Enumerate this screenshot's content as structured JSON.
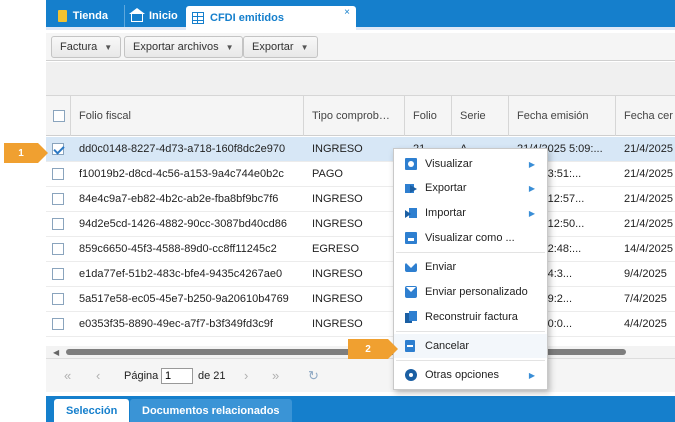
{
  "tabs": [
    {
      "label": "Tienda",
      "icon": "folder-icon"
    },
    {
      "label": "Inicio",
      "icon": "home-icon"
    },
    {
      "label": "CFDI emitidos",
      "icon": "grid-icon",
      "close": "×"
    }
  ],
  "toolbar": {
    "factura": "Factura",
    "exportar_archivos": "Exportar archivos",
    "exportar": "Exportar"
  },
  "columns": {
    "folio_fiscal": "Folio fiscal",
    "tipo": "Tipo comprob…",
    "folio": "Folio",
    "serie": "Serie",
    "fecha_emision": "Fecha emisión",
    "fecha_cert": "Fecha cer"
  },
  "rows": [
    {
      "uuid": "dd0c0148-8227-4d73-a718-160f8dc2e970",
      "tipo": "INGRESO",
      "folio": "21",
      "serie": "A",
      "fecha": "21/4/2025 5:09:...",
      "fecha2": "21/4/2025"
    },
    {
      "uuid": "f10019b2-d8cd-4c56-a153-9a4c744e0b2c",
      "tipo": "PAGO",
      "folio": "",
      "serie": "",
      "fecha": "/2025 3:51:...",
      "fecha2": "21/4/2025"
    },
    {
      "uuid": "84e4c9a7-eb82-4b2c-ab2e-fba8bf9bc7f6",
      "tipo": "INGRESO",
      "folio": "",
      "serie": "",
      "fecha": "/2025 12:57...",
      "fecha2": "21/4/2025"
    },
    {
      "uuid": "94d2e5cd-1426-4882-90cc-3087bd40cd86",
      "tipo": "INGRESO",
      "folio": "",
      "serie": "",
      "fecha": "/2025 12:50...",
      "fecha2": "21/4/2025"
    },
    {
      "uuid": "859c6650-45f3-4588-89d0-cc8ff11245c2",
      "tipo": "EGRESO",
      "folio": "",
      "serie": "",
      "fecha": "/2025 2:48:...",
      "fecha2": "14/4/2025"
    },
    {
      "uuid": "e1da77ef-51b2-483c-bfe4-9435c4267ae0",
      "tipo": "INGRESO",
      "folio": "",
      "serie": "",
      "fecha": "25 4:44:3...",
      "fecha2": "9/4/2025"
    },
    {
      "uuid": "5a517e58-ec05-45e7-b250-9a20610b4769",
      "tipo": "INGRESO",
      "folio": "",
      "serie": "",
      "fecha": "25 4:29:2...",
      "fecha2": "7/4/2025"
    },
    {
      "uuid": "e0353f35-8890-49ec-a7f7-b3f349fd3c9f",
      "tipo": "INGRESO",
      "folio": "",
      "serie": "",
      "fecha": "25 2:00:0...",
      "fecha2": "4/4/2025"
    }
  ],
  "pager": {
    "pagina": "Página",
    "current": "1",
    "de": "de 21"
  },
  "menu": {
    "visualizar": "Visualizar",
    "exportar": "Exportar",
    "importar": "Importar",
    "visualizar_como": "Visualizar como ...",
    "enviar": "Enviar",
    "enviar_personalizado": "Enviar personalizado",
    "reconstruir": "Reconstruir factura",
    "cancelar": "Cancelar",
    "otras": "Otras opciones"
  },
  "bottom_tabs": {
    "seleccion": "Selección",
    "documentos": "Documentos relacionados"
  },
  "markers": {
    "m1": "1",
    "m2": "2"
  },
  "colors": {
    "brand_blue": "#157fcc",
    "marker_orange": "#f0a030",
    "selected_row": "#d7e7f6"
  }
}
